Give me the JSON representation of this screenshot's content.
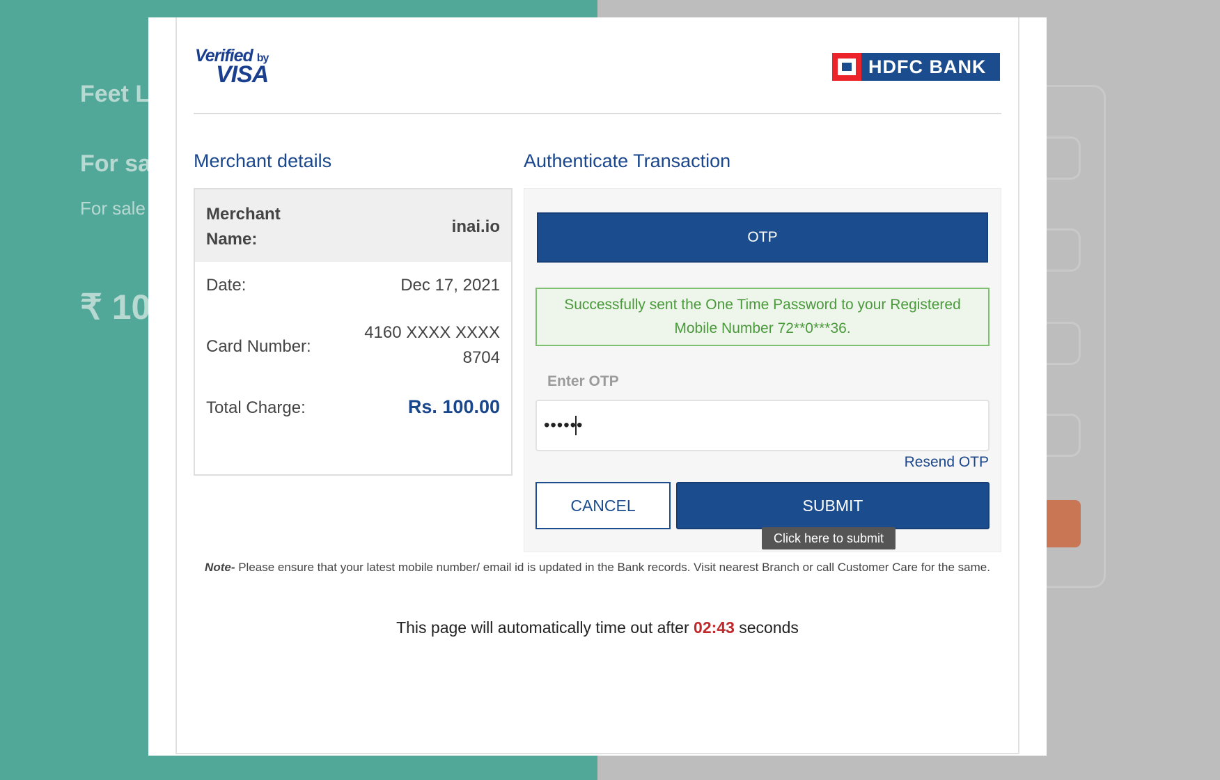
{
  "background": {
    "line1": "Feet L",
    "line2": "For sal",
    "line3": "For sale",
    "price": "₹ 10("
  },
  "header": {
    "visa_verified": "Verified",
    "visa_by": "by",
    "visa_word": "VISA",
    "bank_name": "HDFC BANK"
  },
  "merchant": {
    "title": "Merchant details",
    "name_label": "Merchant Name:",
    "name_value": "inai.io",
    "date_label": "Date:",
    "date_value": "Dec 17, 2021",
    "card_label": "Card Number:",
    "card_value": "4160 XXXX XXXX 8704",
    "total_label": "Total Charge:",
    "total_value": "Rs. 100.00"
  },
  "auth": {
    "title": "Authenticate Transaction",
    "tab_label": "OTP",
    "success_message": "Successfully sent the One Time Password to your Registered Mobile Number 72**0***36.",
    "otp_label": "Enter OTP",
    "otp_value": "••••••",
    "resend_label": "Resend OTP",
    "cancel_label": "CANCEL",
    "submit_label": "SUBMIT",
    "submit_tooltip": "Click here to submit"
  },
  "footer": {
    "note_prefix": "Note-",
    "note_text": " Please ensure that your latest mobile number/ email id is updated in the Bank records. Visit nearest Branch or call Customer Care for the same.",
    "timeout_prefix": "This page will automatically time out after ",
    "timeout_value": "02:43",
    "timeout_suffix": " seconds"
  },
  "colors": {
    "brand_blue": "#1b4d8e",
    "success_green": "#4a9a3c",
    "timer_red": "#c0282b",
    "background_teal": "#51a898"
  }
}
